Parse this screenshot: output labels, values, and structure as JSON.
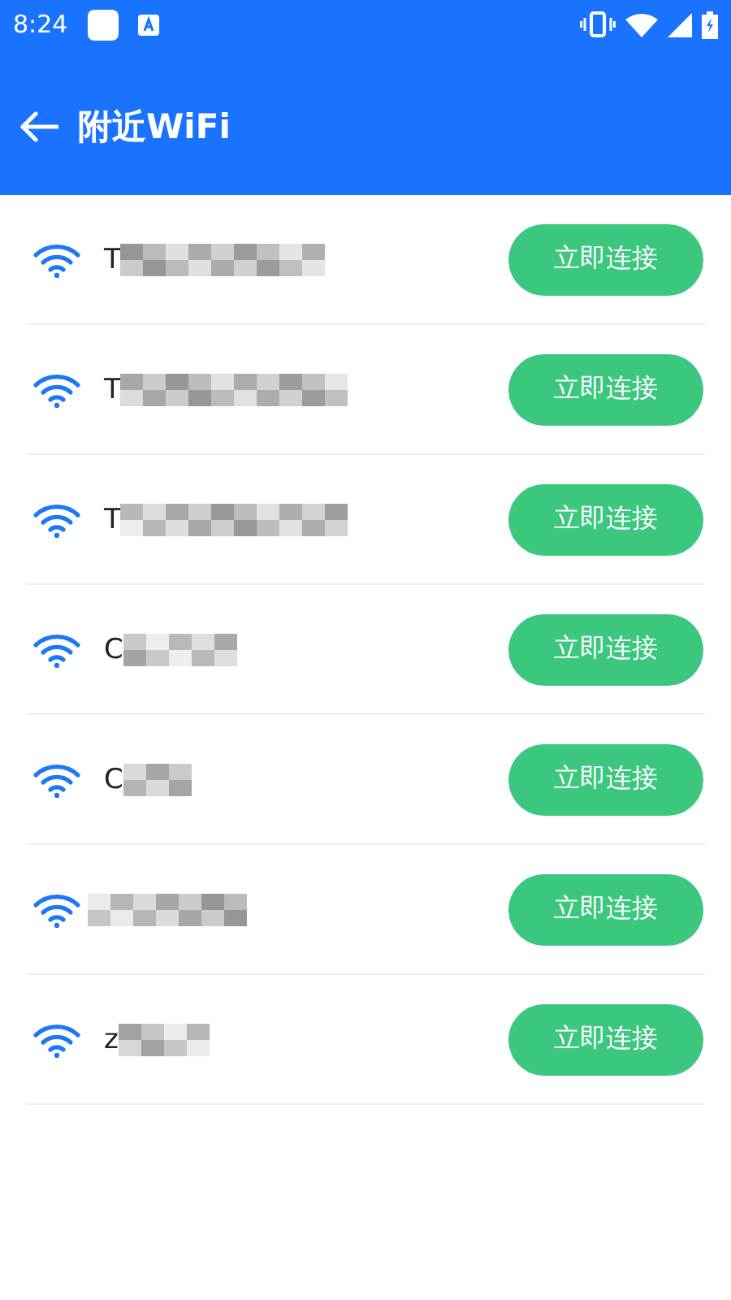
{
  "status_bar": {
    "time": "8:24"
  },
  "header": {
    "title": "附近WiFi"
  },
  "networks": [
    {
      "name": "T",
      "button": "立即连接"
    },
    {
      "name": "T",
      "button": "立即连接"
    },
    {
      "name": "T",
      "button": "立即连接"
    },
    {
      "name": "C",
      "button": "立即连接"
    },
    {
      "name": "C",
      "button": "立即连接"
    },
    {
      "button": "立即连接"
    },
    {
      "name": "z",
      "button": "立即连接"
    }
  ]
}
